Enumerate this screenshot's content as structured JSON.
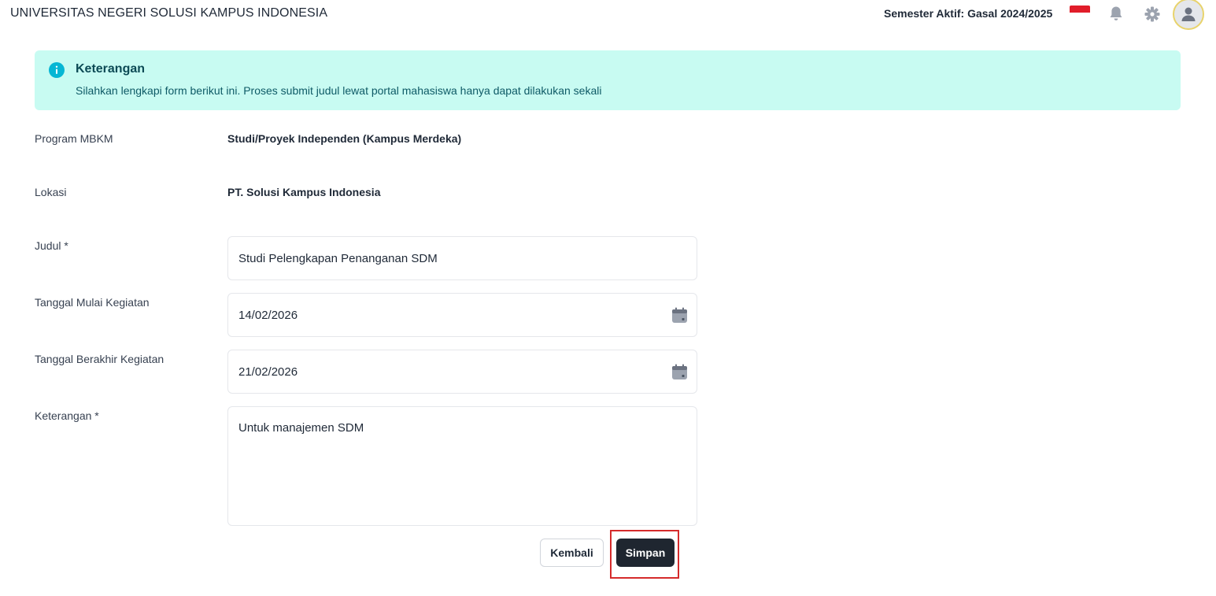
{
  "header": {
    "title": "UNIVERSITAS NEGERI SOLUSI KAMPUS INDONESIA",
    "semester_label": "Semester Aktif: Gasal 2024/2025"
  },
  "info": {
    "title": "Keterangan",
    "message": "Silahkan lengkapi form berikut ini. Proses submit judul lewat portal mahasiswa hanya dapat dilakukan sekali"
  },
  "form": {
    "program_label": "Program MBKM",
    "program_value": "Studi/Proyek Independen (Kampus Merdeka)",
    "lokasi_label": "Lokasi",
    "lokasi_value": "PT. Solusi Kampus Indonesia",
    "judul_label": "Judul *",
    "judul_value": "Studi Pelengkapan Penanganan SDM",
    "mulai_label": "Tanggal Mulai Kegiatan",
    "mulai_value": "14/02/2026",
    "berakhir_label": "Tanggal Berakhir Kegiatan",
    "berakhir_value": "21/02/2026",
    "keterangan_label": "Keterangan *",
    "keterangan_value": "Untuk manajemen SDM"
  },
  "actions": {
    "back_label": "Kembali",
    "save_label": "Simpan"
  },
  "colors": {
    "info_bg": "#c8fbf2",
    "info_icon": "#06b6d4",
    "primary_button": "#1f2630",
    "highlight": "#d52b2b"
  },
  "icons": {
    "info": "info-icon",
    "bell": "bell-icon",
    "gear": "gear-icon",
    "avatar": "user-icon",
    "calendar": "calendar-icon"
  }
}
